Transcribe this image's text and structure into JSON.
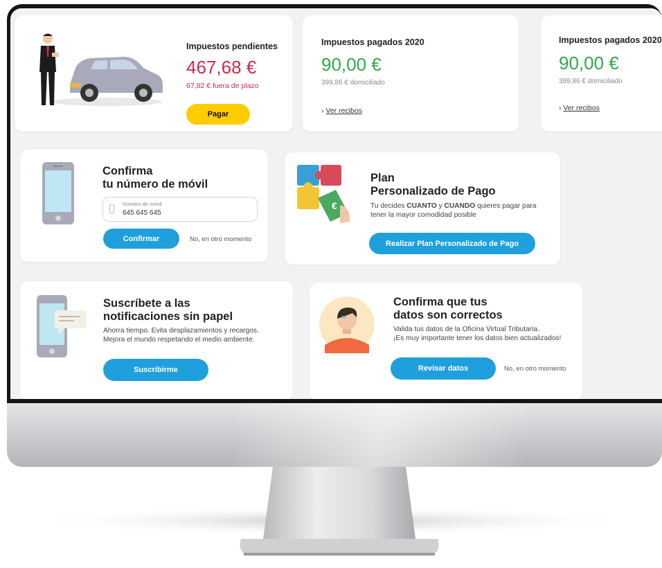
{
  "tax_cards": {
    "pending": {
      "title": "Impuestos pendientes",
      "amount": "467,68 €",
      "note": "67,82 € fuera de plazo",
      "button": "Pagar"
    },
    "paid_1": {
      "title": "Impuestos pagados 2020",
      "amount": "90,00 €",
      "note": "399,86 € domiciliado",
      "link_arrow": "›",
      "link": "Ver recibos"
    },
    "paid_2": {
      "title": "Impuestos pagados 2020",
      "amount": "90,00 €",
      "note": "399,86 € domiciliado",
      "link_arrow": "›",
      "link": "Ver recibos"
    }
  },
  "phone_card": {
    "heading_line1": "Confirma",
    "heading_line2": "tu número de móvil",
    "input_label": "Número de móvil",
    "input_value": "645 645 645",
    "confirm_button": "Confirmar",
    "later_link": "No, en otro momento"
  },
  "plan_card": {
    "heading_line1": "Plan",
    "heading_line2": "Personalizado de Pago",
    "desc_prefix": "Tu decides ",
    "desc_bold1": "CUANTO",
    "desc_mid": " y ",
    "desc_bold2": "CUANDO",
    "desc_suffix": " quieres pagar para",
    "desc_line2": "tener la mayor comodidad posible",
    "button": "Realizar Plan Personalizado de Pago",
    "euro_symbol": "€"
  },
  "subscribe_card": {
    "heading_line1": "Suscríbete a las",
    "heading_line2": "notificaciones sin papel",
    "desc_line1": "Ahorra tiempo. Evita desplazamientos y recargos.",
    "desc_line2": "Mejora el mundo respetando el medio ambiente.",
    "button": "Suscribirme"
  },
  "data_card": {
    "heading_line1": "Confirma que tus",
    "heading_line2": "datos son correctos",
    "desc_line1": "Valida tus datos de la Oficina Virtual Tributaria.",
    "desc_line2": "¡Es muy importante tener los datos bien actualizados!",
    "button": "Revisar datos",
    "later_link": "No, en otro momento"
  },
  "colors": {
    "accent_blue": "#1fa0dc",
    "accent_yellow": "#ffcc00",
    "amount_red": "#cc2a4c",
    "amount_green": "#2eaa49"
  },
  "icons": {
    "pending_illustration": "businessman-car-illustration",
    "phone_illustration": "smartphone-icon",
    "plan_illustration": "puzzle-payment-illustration",
    "subscribe_illustration": "phone-notification-icon",
    "data_illustration": "user-avatar-illustration"
  }
}
